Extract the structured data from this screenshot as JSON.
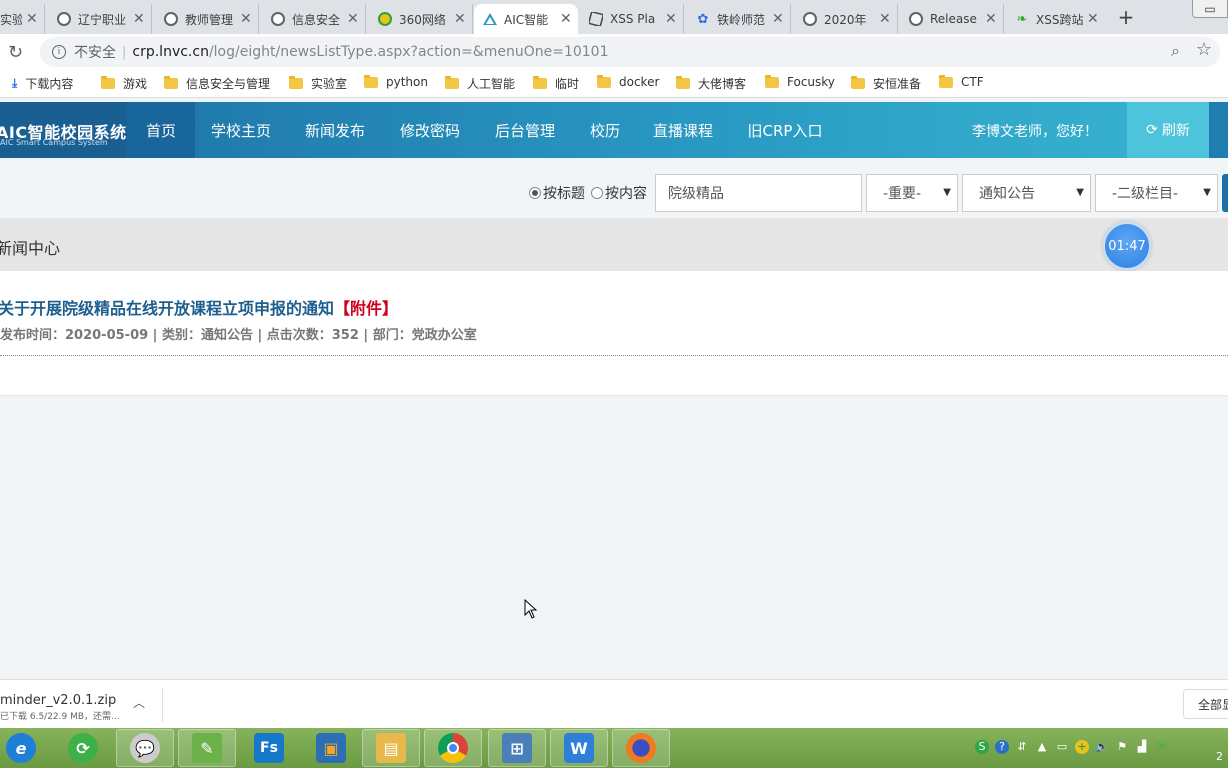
{
  "browser": {
    "tabs": [
      {
        "title": "实验"
      },
      {
        "title": "辽宁职业"
      },
      {
        "title": "教师管理"
      },
      {
        "title": "信息安全"
      },
      {
        "title": "360网络"
      },
      {
        "title": "AIC智能",
        "active": true
      },
      {
        "title": "XSS Pla"
      },
      {
        "title": "铁岭师范"
      },
      {
        "title": "2020年"
      },
      {
        "title": "Release"
      },
      {
        "title": "XSS跨站"
      }
    ],
    "new_tab": "+",
    "address": {
      "security": "不安全",
      "host": "crp.lnvc.cn",
      "path": "/log/eight/newsListType.aspx?action=&menuOne=10101"
    },
    "bookmarks": [
      {
        "label": "下载内容",
        "icon": "download-icon"
      },
      {
        "label": "游戏",
        "icon": "folder-icon"
      },
      {
        "label": "信息安全与管理",
        "icon": "folder-icon"
      },
      {
        "label": "实验室",
        "icon": "folder-icon"
      },
      {
        "label": "python",
        "icon": "folder-icon"
      },
      {
        "label": "人工智能",
        "icon": "folder-icon"
      },
      {
        "label": "临时",
        "icon": "folder-icon"
      },
      {
        "label": "docker",
        "icon": "folder-icon"
      },
      {
        "label": "大佬博客",
        "icon": "folder-icon"
      },
      {
        "label": "Focusky",
        "icon": "folder-icon"
      },
      {
        "label": "安恒准备",
        "icon": "folder-icon"
      },
      {
        "label": "CTF",
        "icon": "folder-icon"
      }
    ]
  },
  "site": {
    "logo": {
      "main": "AIC智能校园系统",
      "sub": "AIC Smart Campus System"
    },
    "nav": [
      "首页",
      "学校主页",
      "新闻发布",
      "修改密码",
      "后台管理",
      "校历",
      "直播课程",
      "旧CRP入口"
    ],
    "greeting": "李博文老师，您好！",
    "refresh": "刷新",
    "search": {
      "radio_title": "按标题",
      "radio_content": "按内容",
      "keyword": "院级精品",
      "importance": "-重要-",
      "category": "通知公告",
      "subcolumn": "-二级栏目-"
    },
    "section_title": "新闻中心",
    "timer": "01:47",
    "news": {
      "title": "关于开展院级精品在线开放课程立项申报的通知",
      "tag": "【附件】",
      "meta": "发布时间：2020-05-09 | 类别：通知公告 | 点击次数：352 | 部门：党政办公室"
    }
  },
  "downloads": {
    "file": "minder_v2.0.1.zip",
    "progress": "已下载 6.5/22.9 MB，还需...",
    "show_all": "全部显示"
  },
  "colors": {
    "header_blue": "#1d6fa5",
    "title_blue": "#1e5f8e",
    "tag_red": "#d0021b",
    "taskbar_green": "#6a9a42"
  }
}
